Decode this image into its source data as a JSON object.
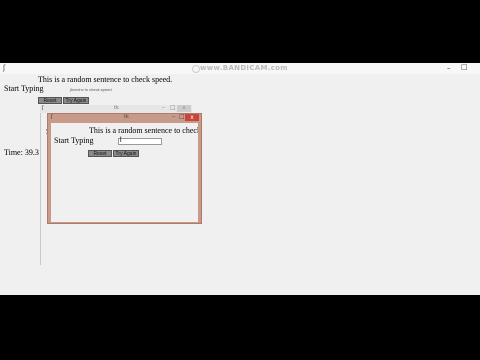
{
  "watermark": {
    "text": "www.BANDICAM.com"
  },
  "main_window": {
    "title": "",
    "sentence": "This is a random sentence to check speed.",
    "prompt_label": "Start Typing",
    "typed_text": "jhvnvhv to check speed",
    "buttons": {
      "reset": "Reset",
      "try_again": "Try Again"
    },
    "time_label": "Time: 39.3",
    "clipped_letter": "S"
  },
  "ghost_window": {
    "title": "tk"
  },
  "dialog": {
    "title": "tk",
    "sentence": "This is a random sentence to check speed.",
    "prompt_label": "Start Typing",
    "input_value": "l",
    "buttons": {
      "reset": "Reset",
      "try_again": "Try Again"
    }
  },
  "icons": {
    "window_icon": "feather-icon",
    "minimize": "minimize-icon",
    "maximize": "maximize-icon",
    "close": "close-icon",
    "close_glyph": "x"
  },
  "colors": {
    "dialog_frame": "#c89a8a",
    "close_button": "#c9453a",
    "button_face": "#8a8a8a"
  }
}
